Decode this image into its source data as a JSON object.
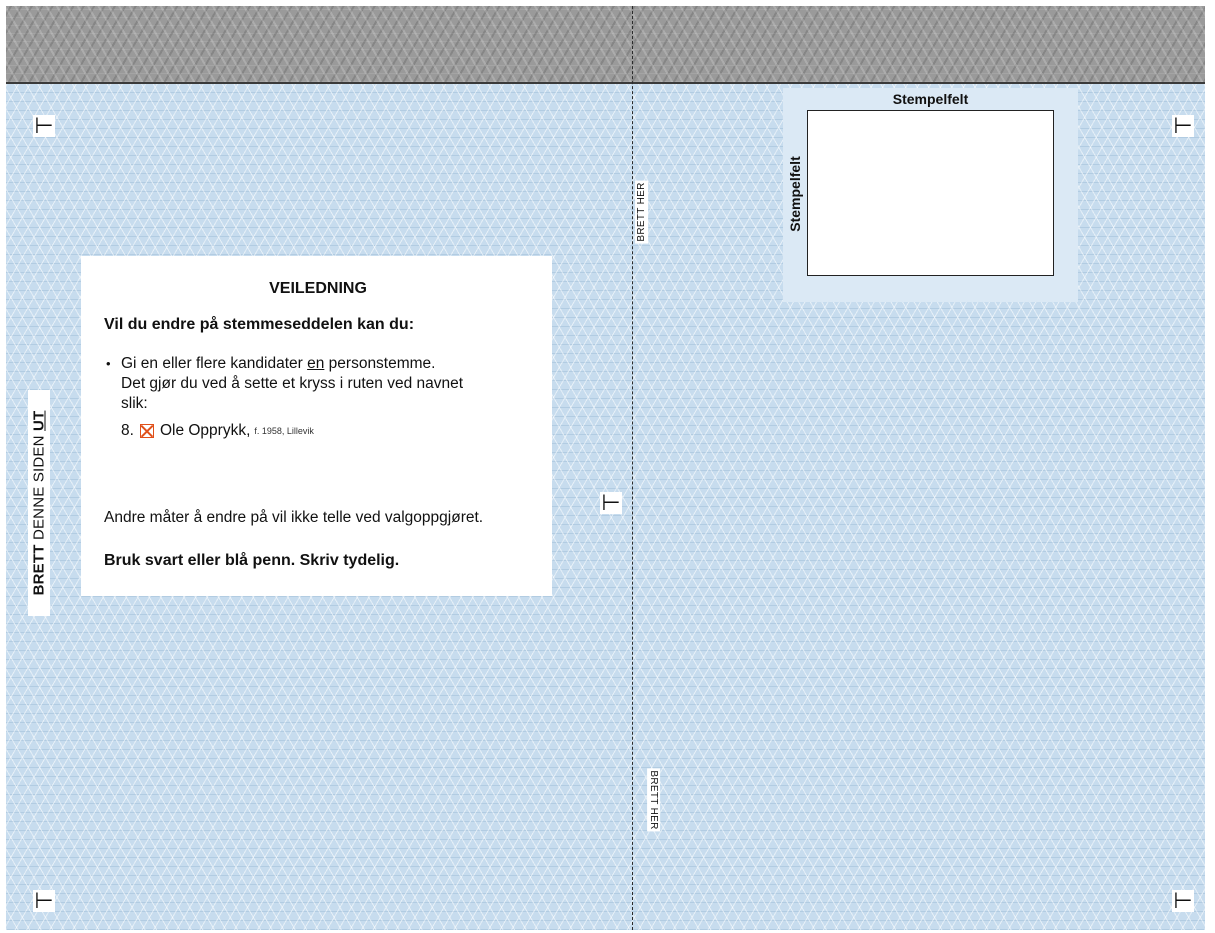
{
  "corner_mark_glyph": "⊢",
  "fold_here_label": "BRETT HER",
  "fold_side_out": {
    "bold_word": "BRETT",
    "middle_text": " DENNE SIDEN ",
    "underlined_word": "UT"
  },
  "instructions": {
    "title": "VEILEDNING",
    "lead": "Vil du endre på stemmeseddelen kan du:",
    "bullet_glyph": "•",
    "bullet_before": "Gi en eller flere kandidater ",
    "bullet_underlined": "en",
    "bullet_after": " personstemme.",
    "bullet_line2": "Det gjør du ved å sette et kryss i ruten ved navnet",
    "bullet_line3": "slik:",
    "example_number": "8.",
    "example_name": "Ole Opprykk,",
    "example_details": "f. 1958, Lillevik",
    "note": "Andre måter å endre på vil ikke telle ved valgoppgjøret.",
    "pen_instruction": "Bruk svart eller blå penn. Skriv tydelig."
  },
  "stamp_field": {
    "label_top": "Stempelfelt",
    "label_side": "Stempelfelt"
  },
  "colors": {
    "ballot_background": "#c7dcee",
    "stamp_zone_background": "#dbe9f5",
    "header_strip": "#9a9a9a",
    "checkbox_mark": "#e0501a"
  }
}
